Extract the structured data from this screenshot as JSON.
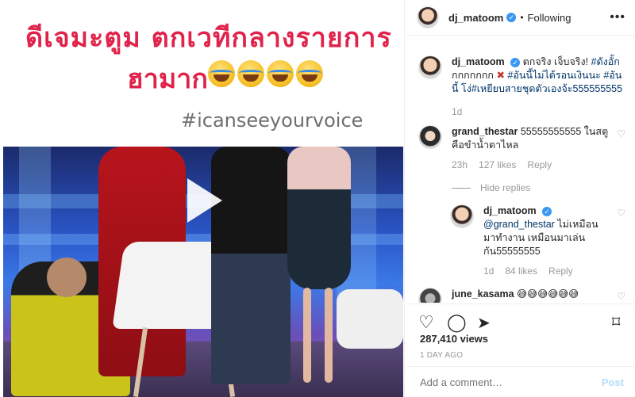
{
  "media": {
    "thai_line1": "ดีเจมะตูม ตกเวทีกลางรายการ",
    "thai_line2": "ฮามาก",
    "hashtag": "#icanseeyourvoice",
    "emoji_count": 4,
    "play_icon": "play-icon"
  },
  "header": {
    "username": "dj_matoom",
    "verified_icon": "verified-badge",
    "separator": "•",
    "follow_status": "Following",
    "more_icon": "more-options-icon"
  },
  "comments": [
    {
      "username": "dj_matoom",
      "text_main": "ตกจริง เจ็บจริง! ",
      "text_tag1": "#ดังอั้ก",
      "text_mid": "กกกกกกก ",
      "text_rest": "#อันนี้ไม่ได้รอนเงินนะ #อันนี้ โง่#เหยียบสายชุดตัวเองจ้ะ555555555",
      "time": "1d"
    },
    {
      "username": "grand_thestar",
      "text": "55555555555 ในสตู คือขำน้ำตาไหล",
      "time": "23h",
      "likes": "127 likes",
      "reply": "Reply",
      "hide_replies": "Hide replies"
    },
    {
      "username": "dj_matoom",
      "mention": "@grand_thestar",
      "text": " ไม่เหมือน มาทำงาน เหมือนมาเล่น กัน55555555",
      "time": "1d",
      "likes": "84 likes",
      "reply": "Reply"
    },
    {
      "username": "june_kasama",
      "text": "😅😅😅😅😅😅"
    }
  ],
  "post": {
    "views": "287,410 views",
    "date": "1 DAY AGO",
    "add_comment_placeholder": "Add a comment…",
    "post_label": "Post"
  }
}
